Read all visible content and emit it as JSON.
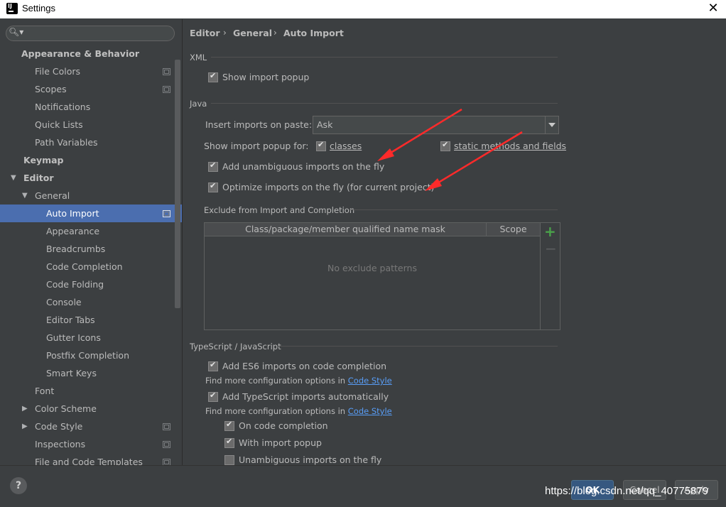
{
  "window": {
    "title": "Settings"
  },
  "search": {
    "placeholder": ""
  },
  "sidebar": {
    "items": [
      {
        "label": "Appearance & Behavior",
        "level": 0,
        "bold": true
      },
      {
        "label": "File Colors",
        "level": 1,
        "copy": true
      },
      {
        "label": "Scopes",
        "level": 1,
        "copy": true
      },
      {
        "label": "Notifications",
        "level": 1
      },
      {
        "label": "Quick Lists",
        "level": 1
      },
      {
        "label": "Path Variables",
        "level": 1
      },
      {
        "label": "Keymap",
        "level": 0,
        "bold": true
      },
      {
        "label": "Editor",
        "level": 0,
        "bold": true,
        "expanded": true
      },
      {
        "label": "General",
        "level": 1,
        "expanded": true
      },
      {
        "label": "Auto Import",
        "level": 2,
        "selected": true,
        "copy": true
      },
      {
        "label": "Appearance",
        "level": 2
      },
      {
        "label": "Breadcrumbs",
        "level": 2
      },
      {
        "label": "Code Completion",
        "level": 2
      },
      {
        "label": "Code Folding",
        "level": 2
      },
      {
        "label": "Console",
        "level": 2
      },
      {
        "label": "Editor Tabs",
        "level": 2
      },
      {
        "label": "Gutter Icons",
        "level": 2
      },
      {
        "label": "Postfix Completion",
        "level": 2
      },
      {
        "label": "Smart Keys",
        "level": 2
      },
      {
        "label": "Font",
        "level": 1
      },
      {
        "label": "Color Scheme",
        "level": 1,
        "collapsed": true
      },
      {
        "label": "Code Style",
        "level": 1,
        "collapsed": true,
        "copy": true
      },
      {
        "label": "Inspections",
        "level": 1,
        "copy": true
      },
      {
        "label": "File and Code Templates",
        "level": 1,
        "copy": true
      }
    ]
  },
  "breadcrumb": {
    "items": [
      "Editor",
      "General",
      "Auto Import"
    ],
    "separator": "›"
  },
  "xml": {
    "section": "XML",
    "show_import_popup": {
      "label": "Show import popup",
      "checked": true
    }
  },
  "java": {
    "section": "Java",
    "insert_on_paste_label": "Insert imports on paste:",
    "insert_on_paste_value": "Ask",
    "show_popup_for_label": "Show import popup for:",
    "classes": {
      "label": "classes",
      "checked": true
    },
    "static_methods": {
      "label": "static methods and fields",
      "checked": true
    },
    "add_unambiguous": {
      "label": "Add unambiguous imports on the fly",
      "checked": true
    },
    "optimize": {
      "label": "Optimize imports on the fly (for current project)",
      "checked": true
    },
    "exclude_section": "Exclude from Import and Completion",
    "table": {
      "col_mask": "Class/package/member qualified name mask",
      "col_scope": "Scope",
      "empty": "No exclude patterns"
    }
  },
  "ts": {
    "section": "TypeScript / JavaScript",
    "es6": {
      "label": "Add ES6 imports on code completion",
      "checked": true
    },
    "find_more_1": "Find more configuration options in",
    "code_style_link": "Code Style",
    "ts_auto": {
      "label": "Add TypeScript imports automatically",
      "checked": true
    },
    "find_more_2": "Find more configuration options in",
    "on_completion": {
      "label": "On code completion",
      "checked": true
    },
    "with_popup": {
      "label": "With import popup",
      "checked": true
    },
    "unambiguous": {
      "label": "Unambiguous imports on the fly",
      "checked": false
    }
  },
  "buttons": {
    "help": "?",
    "ok": "OK",
    "cancel": "Cancel",
    "apply": "Apply"
  },
  "watermark": "https://blog.csdn.net/qq_40775879",
  "colors": {
    "selection": "#4b6eaf",
    "link": "#589df6",
    "annotation_arrow": "#ff2a2a"
  }
}
